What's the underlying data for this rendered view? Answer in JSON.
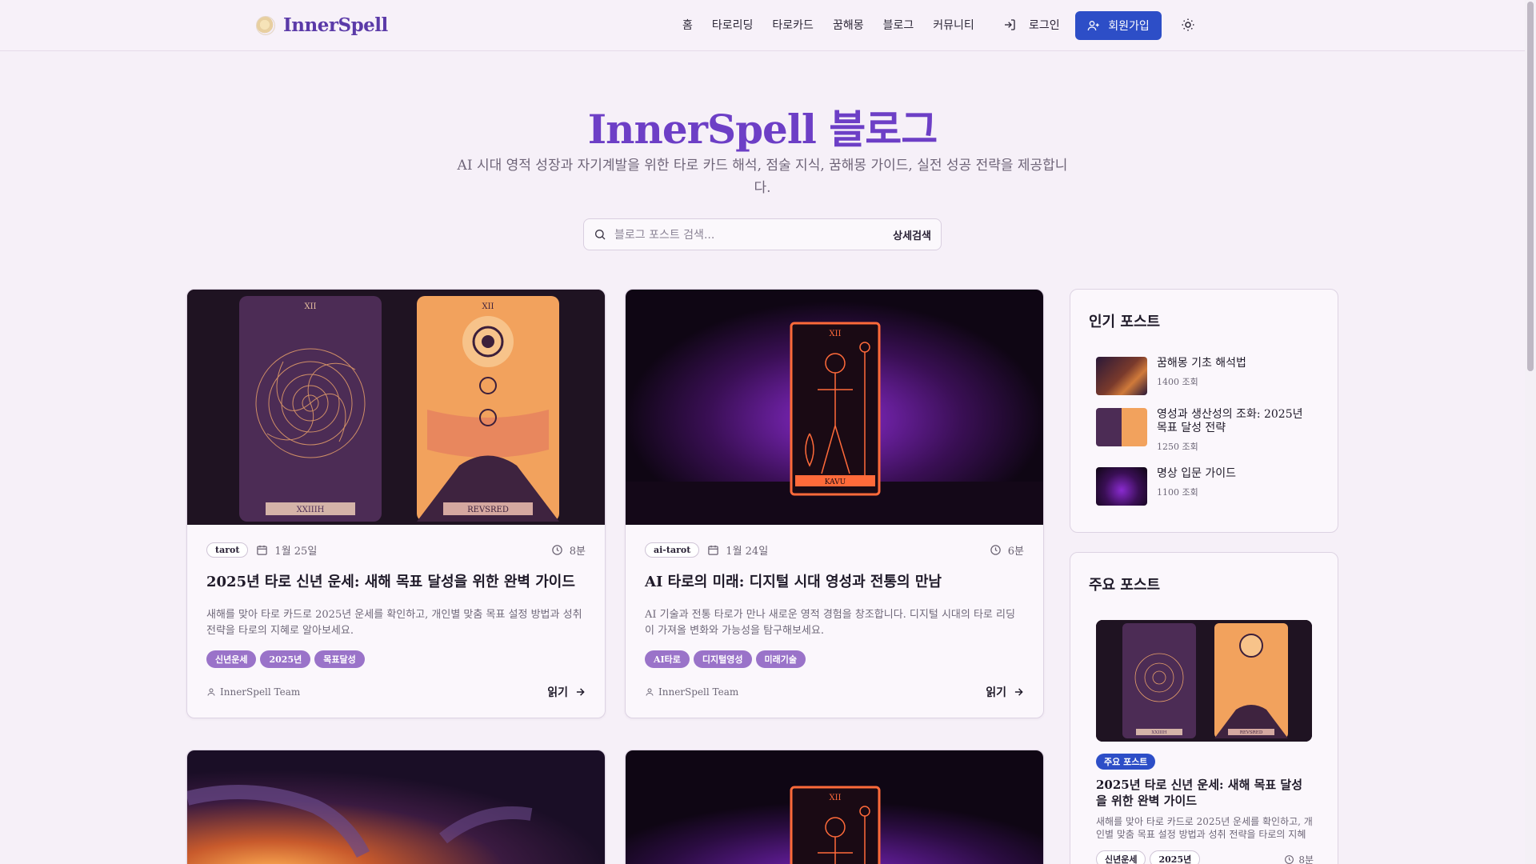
{
  "header": {
    "logo": "InnerSpell",
    "nav": [
      "홈",
      "타로리딩",
      "타로카드",
      "꿈해몽",
      "블로그",
      "커뮤니티"
    ],
    "login": "로그인",
    "signup": "회원가입"
  },
  "hero": {
    "title": "InnerSpell 블로그",
    "subtitle": "AI 시대 영적 성장과 자기계발을 위한 타로 카드 해석, 점술 지식, 꿈해몽 가이드, 실전 성공 전략을 제공합니다.",
    "search_placeholder": "블로그 포스트 검색...",
    "advanced_search": "상세검색"
  },
  "posts": [
    {
      "category": "tarot",
      "date": "1월 25일",
      "read_time": "8분",
      "title": "2025년 타로 신년 운세: 새해 목표 달성을 위한 완벽 가이드",
      "desc": "새해를 맞아 타로 카드로 2025년 운세를 확인하고, 개인별 맞춤 목표 설정 방법과 성취 전략을 타로의 지혜로 알아보세요.",
      "tags": [
        "신년운세",
        "2025년",
        "목표달성"
      ],
      "author": "InnerSpell Team",
      "read": "읽기",
      "img_left_num": "XII",
      "img_left_label": "XXIIIH",
      "img_right_num": "XII",
      "img_right_label": "REVSRED"
    },
    {
      "category": "ai-tarot",
      "date": "1월 24일",
      "read_time": "6분",
      "title": "AI 타로의 미래: 디지털 시대 영성과 전통의 만남",
      "desc": "AI 기술과 전통 타로가 만나 새로운 영적 경험을 창조합니다. 디지털 시대의 타로 리딩이 가져올 변화와 가능성을 탐구해보세요.",
      "tags": [
        "AI타로",
        "디지털영성",
        "미래기술"
      ],
      "author": "InnerSpell Team",
      "read": "읽기",
      "img_num": "XII",
      "img_label": "KAVU"
    }
  ],
  "bottom_card_num": "XII",
  "sidebar": {
    "popular_title": "인기 포스트",
    "popular": [
      {
        "title": "꿈해몽 기초 해석법",
        "views": "1400 조회"
      },
      {
        "title": "영성과 생산성의 조화: 2025년 목표 달성 전략",
        "views": "1250 조회"
      },
      {
        "title": "명상 입문 가이드",
        "views": "1100 조회"
      }
    ],
    "featured_title": "주요 포스트",
    "featured": {
      "badge": "주요 포스트",
      "title": "2025년 타로 신년 운세: 새해 목표 달성을 위한 완벽 가이드",
      "desc": "새해를 맞아 타로 카드로 2025년 운세를 확인하고, 개인별 맞춤 목표 설정 방법과 성취 전략을 타로의 지혜로 ...",
      "tags": [
        "신년운세",
        "2025년"
      ],
      "read_time": "8분",
      "img_left_label": "XXIIIH",
      "img_right_label": "REVSRED"
    }
  },
  "colors": {
    "accent": "#6d3fc6",
    "primary": "#2d4ec7",
    "tag": "#9a73c9",
    "bg": "#f6f0f8"
  }
}
